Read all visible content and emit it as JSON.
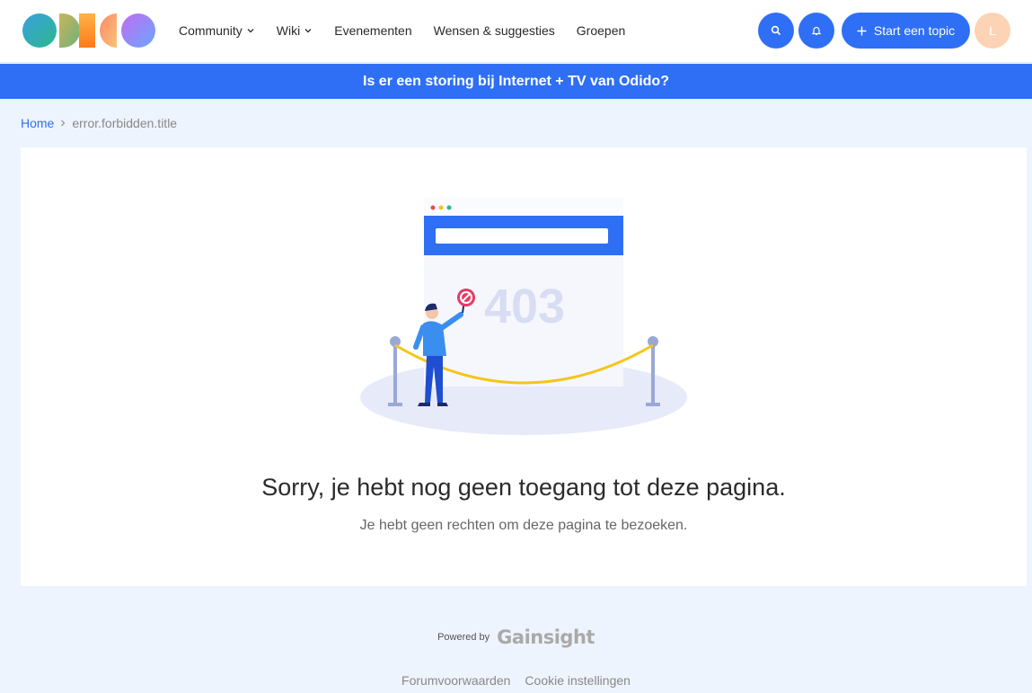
{
  "header": {
    "logo_alt": "Odido",
    "nav": [
      {
        "label": "Community",
        "dropdown": true
      },
      {
        "label": "Wiki",
        "dropdown": true
      },
      {
        "label": "Evenementen",
        "dropdown": false
      },
      {
        "label": "Wensen & suggesties",
        "dropdown": false
      },
      {
        "label": "Groepen",
        "dropdown": false
      }
    ],
    "start_topic_label": "Start een topic",
    "avatar_initial": "L"
  },
  "banner": {
    "text": "Is er een storing bij Internet + TV van Odido?"
  },
  "breadcrumb": {
    "home": "Home",
    "current": "error.forbidden.title"
  },
  "error": {
    "code": "403",
    "title": "Sorry, je hebt nog geen toegang tot deze pagina.",
    "subtitle": "Je hebt geen rechten om deze pagina te bezoeken."
  },
  "footer": {
    "powered_by": "Powered by",
    "brand": "Gainsight",
    "links": [
      "Forumvoorwaarden",
      "Cookie instellingen"
    ]
  },
  "colors": {
    "primary": "#2f6ff5",
    "avatar_bg": "#fcd3b4",
    "page_bg": "#eef4fd",
    "rope": "#f5c518"
  }
}
